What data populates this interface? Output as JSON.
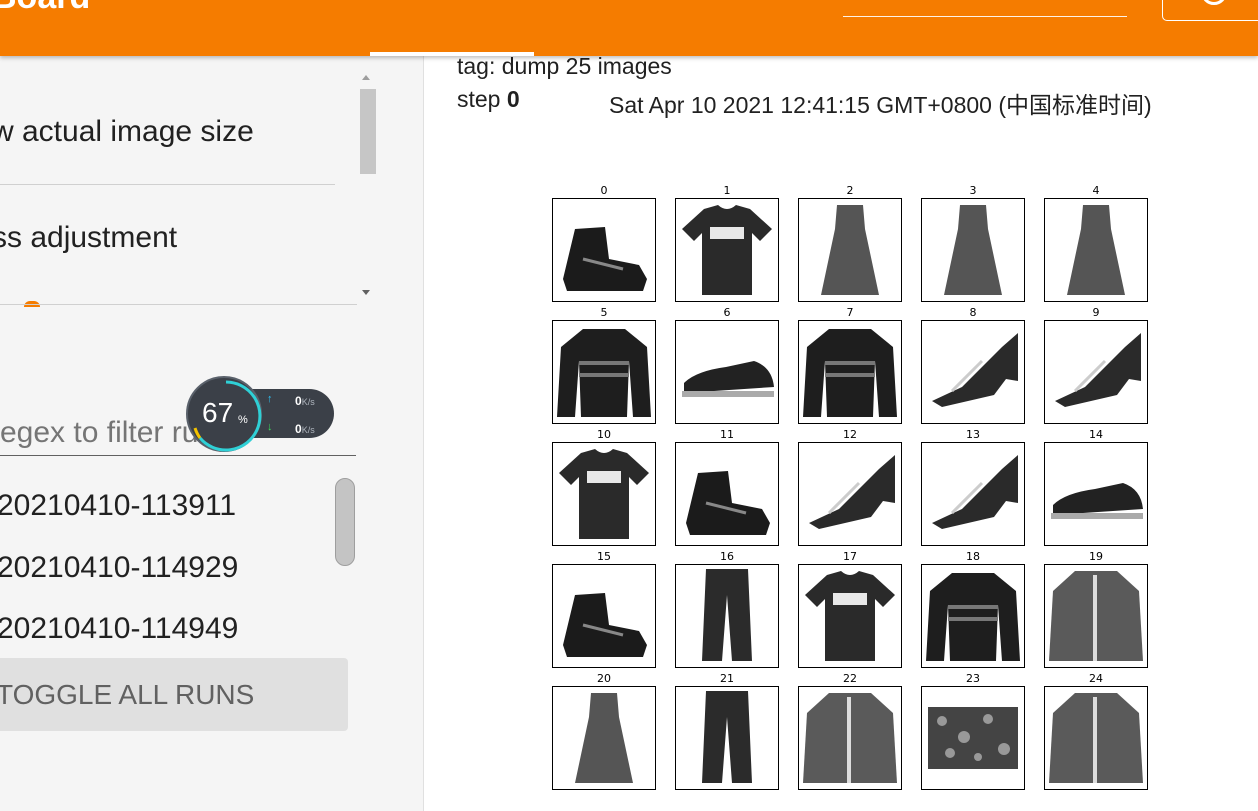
{
  "header": {
    "brand": "Board",
    "colors": {
      "accent": "#f57c00"
    }
  },
  "sidebar": {
    "options": [
      {
        "label": "w actual image size"
      },
      {
        "label": "ss adjustment"
      }
    ],
    "filter_placeholder": "egex to filter runs",
    "runs": [
      "20210410-113911",
      "20210410-114929",
      "20210410-114949"
    ],
    "toggle_all_label": "TOGGLE ALL RUNS"
  },
  "speed_widget": {
    "percent": "67",
    "percent_unit": "%",
    "upload_value": "0",
    "download_value": "0",
    "rate_unit": "K/s"
  },
  "main": {
    "tag_line": "tag: dump 25 images",
    "step_label": "step",
    "step_value": "0",
    "timestamp": "Sat Apr 10 2021 12:41:15 GMT+0800 (中国标准时间)",
    "images": [
      {
        "label": "0",
        "icon": "ankle-boot-icon"
      },
      {
        "label": "1",
        "icon": "tshirt-icon"
      },
      {
        "label": "2",
        "icon": "dress-icon"
      },
      {
        "label": "3",
        "icon": "dress-icon"
      },
      {
        "label": "4",
        "icon": "dress-icon"
      },
      {
        "label": "5",
        "icon": "pullover-icon"
      },
      {
        "label": "6",
        "icon": "sneaker-icon"
      },
      {
        "label": "7",
        "icon": "pullover-icon"
      },
      {
        "label": "8",
        "icon": "sandal-icon"
      },
      {
        "label": "9",
        "icon": "sandal-icon"
      },
      {
        "label": "10",
        "icon": "tshirt-icon"
      },
      {
        "label": "11",
        "icon": "ankle-boot-icon"
      },
      {
        "label": "12",
        "icon": "sandal-icon"
      },
      {
        "label": "13",
        "icon": "sandal-icon"
      },
      {
        "label": "14",
        "icon": "sneaker-icon"
      },
      {
        "label": "15",
        "icon": "ankle-boot-icon"
      },
      {
        "label": "16",
        "icon": "trouser-icon"
      },
      {
        "label": "17",
        "icon": "tshirt-icon"
      },
      {
        "label": "18",
        "icon": "pullover-icon"
      },
      {
        "label": "19",
        "icon": "coat-icon"
      },
      {
        "label": "20",
        "icon": "dress-icon"
      },
      {
        "label": "21",
        "icon": "trouser-icon"
      },
      {
        "label": "22",
        "icon": "coat-icon"
      },
      {
        "label": "23",
        "icon": "bag-icon"
      },
      {
        "label": "24",
        "icon": "coat-icon"
      }
    ]
  }
}
